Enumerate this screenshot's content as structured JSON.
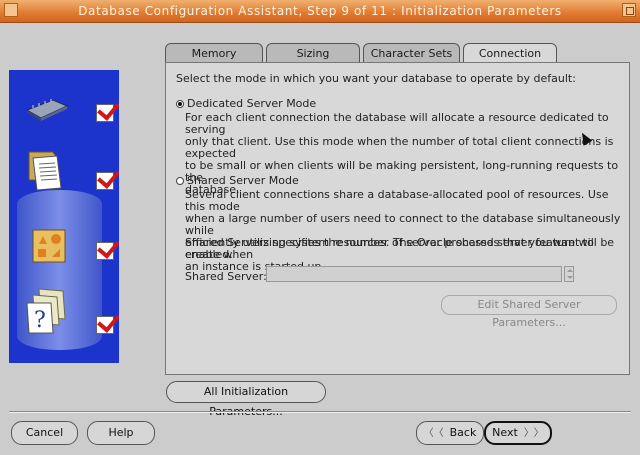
{
  "window": {
    "title": "Database Configuration Assistant, Step 9 of 11 : Initialization Parameters"
  },
  "tabs": [
    {
      "label": "Memory"
    },
    {
      "label": "Sizing"
    },
    {
      "label": "Character Sets"
    },
    {
      "label": "Connection Mode"
    }
  ],
  "active_tab": "Connection Mode",
  "intro": "Select the mode in which you want your database to operate by default:",
  "dedicated": {
    "label": "Dedicated Server Mode",
    "selected": true,
    "desc_lines": [
      "For each client connection the database will allocate a resource dedicated to serving",
      "only that client.  Use this mode when the number of total client connections is expected",
      "to be small or when clients will be making persistent, long-running requests to the",
      "database."
    ]
  },
  "shared": {
    "label": "Shared Server Mode",
    "selected": false,
    "desc_lines": [
      "Several client connections share a database-allocated pool of resources.  Use this mode",
      "when a large number of users need to connect to the database simultaneously while",
      "efficiently utilizing system resources.  The Oracle shared server feature will be enabled."
    ],
    "servers_desc_lines": [
      "Shared Servers specifies the number of server processes that you want to create when",
      "an instance is started up."
    ],
    "server_label": "Shared Server:",
    "server_value": "",
    "edit_button": "Edit Shared Server Parameters..."
  },
  "buttons": {
    "all_params": "All Initialization Parameters...",
    "cancel": "Cancel",
    "help": "Help",
    "back": "Back",
    "next": "Next"
  },
  "sidebar_steps": [
    {
      "icon": "chip-icon",
      "checked": true
    },
    {
      "icon": "documents-icon",
      "checked": true
    },
    {
      "icon": "shapes-icon",
      "checked": true
    },
    {
      "icon": "help-documents-icon",
      "checked": true
    }
  ],
  "colors": {
    "titlebar": "#e07a30",
    "sidebar": "#1c33cc",
    "check": "#d01818"
  }
}
